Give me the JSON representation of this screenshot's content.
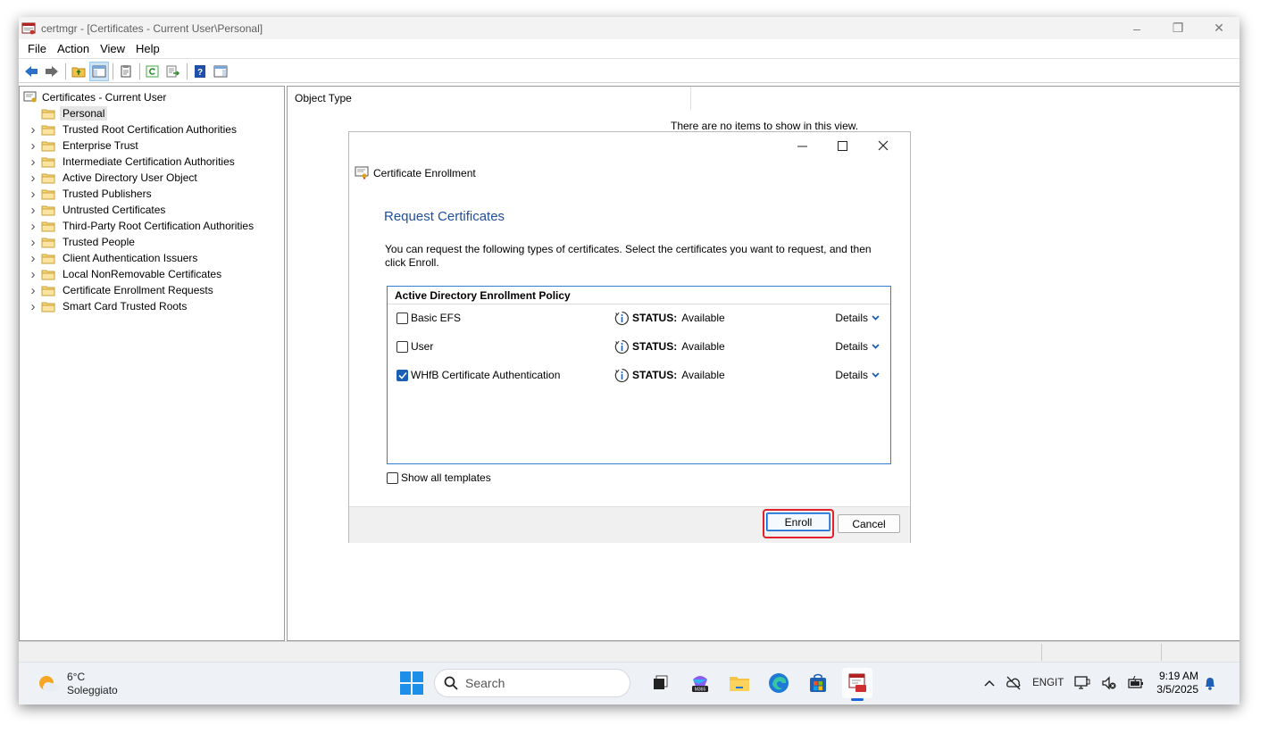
{
  "window": {
    "title": "certmgr - [Certificates - Current User\\Personal]",
    "controls": {
      "minimize": "–",
      "restore": "❐",
      "close": "✕"
    }
  },
  "menu": [
    "File",
    "Action",
    "View",
    "Help"
  ],
  "tree": {
    "root": "Certificates - Current User",
    "items": [
      {
        "label": "Personal",
        "selected": true,
        "expandable": false
      },
      {
        "label": "Trusted Root Certification Authorities",
        "expandable": true
      },
      {
        "label": "Enterprise Trust",
        "expandable": true
      },
      {
        "label": "Intermediate Certification Authorities",
        "expandable": true
      },
      {
        "label": "Active Directory User Object",
        "expandable": true
      },
      {
        "label": "Trusted Publishers",
        "expandable": true
      },
      {
        "label": "Untrusted Certificates",
        "expandable": true
      },
      {
        "label": "Third-Party Root Certification Authorities",
        "expandable": true
      },
      {
        "label": "Trusted People",
        "expandable": true
      },
      {
        "label": "Client Authentication Issuers",
        "expandable": true
      },
      {
        "label": "Local NonRemovable Certificates",
        "expandable": true
      },
      {
        "label": "Certificate Enrollment Requests",
        "expandable": true
      },
      {
        "label": "Smart Card Trusted Roots",
        "expandable": true
      }
    ]
  },
  "content": {
    "column_header": "Object Type",
    "empty_message": "There are no items to show in this view."
  },
  "dialog": {
    "window_title": "Certificate Enrollment",
    "heading": "Request Certificates",
    "description": "You can request the following types of certificates. Select the certificates you want to request, and then click Enroll.",
    "policy_header": "Active Directory Enrollment Policy",
    "certificates": [
      {
        "name": "Basic EFS",
        "checked": false,
        "status_label": "STATUS:",
        "status_value": "Available",
        "details": "Details"
      },
      {
        "name": "User",
        "checked": false,
        "status_label": "STATUS:",
        "status_value": "Available",
        "details": "Details"
      },
      {
        "name": "WHfB Certificate Authentication",
        "checked": true,
        "status_label": "STATUS:",
        "status_value": "Available",
        "details": "Details"
      }
    ],
    "show_all_templates": "Show all templates",
    "enroll_button": "Enroll",
    "cancel_button": "Cancel"
  },
  "taskbar": {
    "weather": {
      "temp": "6°C",
      "condition": "Soleggiato"
    },
    "search_placeholder": "Search",
    "language": {
      "line1": "ENG",
      "line2": "IT"
    },
    "clock": {
      "time": "9:19 AM",
      "date": "3/5/2025"
    }
  },
  "colors": {
    "accent": "#1a5fb4",
    "heading": "#1e4e9c",
    "highlight": "#e0202a"
  }
}
